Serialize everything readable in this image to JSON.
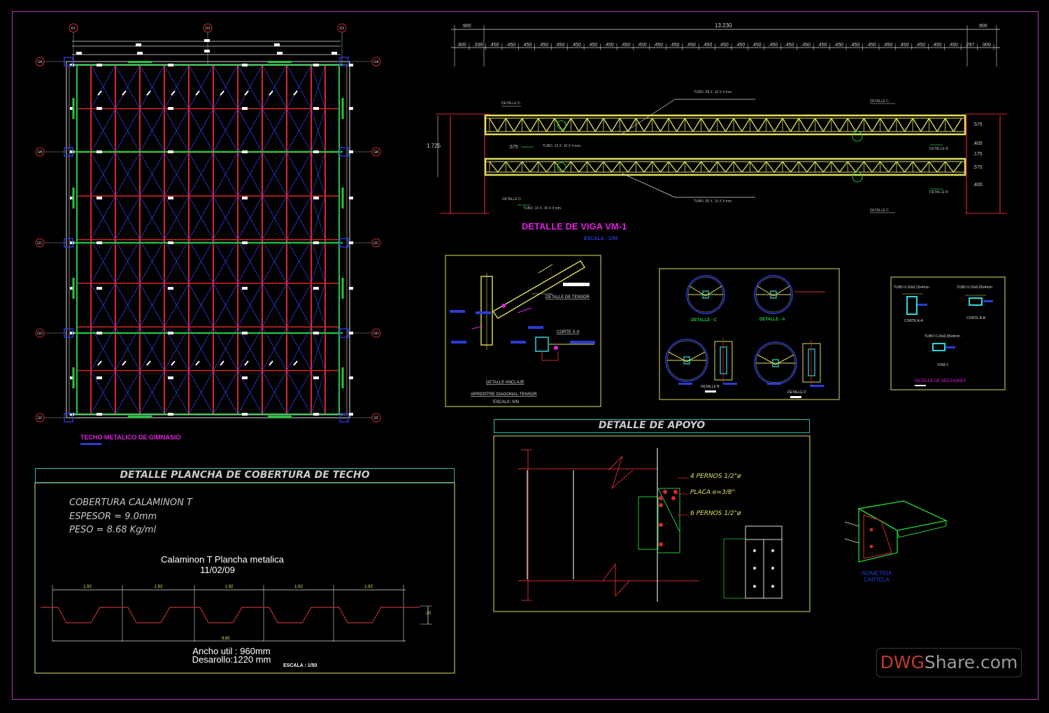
{
  "sheet": {
    "roof_plan_title": "TECHO METALICO DE GIMNASIO",
    "column_grid": [
      "D1",
      "D2",
      "D3"
    ],
    "row_grid": [
      "GA",
      "GB",
      "GC",
      "GD",
      "GE",
      "GF"
    ]
  },
  "beam_detail": {
    "title": "DETALLE DE VIGA VM-1",
    "scale": "ESCALA : 1/50",
    "dim_total": "13.230",
    "dim_end": ".900",
    "dim_start_seg": ".338",
    "dim_seg": ".450",
    "dim_end_seg": ".297",
    "height_total": "1.725",
    "dims_right": [
      ".575",
      ".400",
      ".175",
      ".575",
      ".400"
    ],
    "dim_left_small": ".575",
    "labels": {
      "tubo_top": "TUBO .05 X .10 X 4 mm.",
      "tubo_diag": "TUBO .10 X .10 X 4 mm.",
      "tubo_bottom_left": "TUBO .10 X .15 X 4 mm.",
      "tubo_bottom_right": "TUBO .05 X .10 X 4 mm.",
      "detalle_d": "DETALLE D",
      "detalle_c": "DETALLE C",
      "detalle_b": "DETALLE B"
    }
  },
  "anchor_detail": {
    "tensor": "DETALLE DE TENSOR",
    "corte": "CORTE X-X",
    "anclaje": "DETALLE ANCLAJE",
    "arriostre": "ARRIOSTRE DIAGONAL-TENSOR",
    "scale": "ESCALA: S/N"
  },
  "circle_details": {
    "c": "DETALLE - C",
    "a": "DETALLE - A",
    "b": "DETALLE B",
    "d": "DETALLE D"
  },
  "sections": {
    "tubo_aa": "TUBO 0.10x0.15x4mm",
    "tubo_bb": "TUBO 0.10x0.05x4mm",
    "corte_aa": "CORTE A-A",
    "corte_bb": "CORTE B-B",
    "tubo_vm": "TUBO 0.10x0.05x4mm",
    "vm": "VGM-1",
    "title": "DETALLE DE SECCIONES"
  },
  "apoyo": {
    "title": "DETALLE DE APOYO",
    "pernos_top": "4  PERNOS  1/2\"ø",
    "placa": "PLACA  e=3/8\"",
    "pernos_bot": "6  PERNOS  1/2\"ø",
    "isometria_1": "ISOMETRIA",
    "isometria_2": "CARTELA"
  },
  "plancha": {
    "title": "DETALLE PLANCHA DE COBERTURA DE TECHO",
    "line1": "COBERTURA  CALAMINON  T",
    "line2": "ESPESOR  =  9.0mm",
    "line3": "PESO  =  8.68  Kg/ml",
    "caption": "Calaminon T Plancha metalica",
    "date": "11/02/09",
    "seg": "1.92",
    "width_dim": "9.60",
    "height_dim": ".30",
    "ancho": "Ancho util : 960mm",
    "desarrollo": "Desarollo:1220 mm",
    "scale": "ESCALA : 1/50"
  },
  "watermark": {
    "prefix": "DWG",
    "suffix": "Share.com"
  },
  "colors": {
    "red": "#d4282d",
    "blue": "#2a3bd8",
    "green": "#22c83c",
    "yellow": "#e0e05a",
    "magenta": "#e020e0",
    "cyan": "#30d8d8",
    "frame": "#b43ab4"
  }
}
